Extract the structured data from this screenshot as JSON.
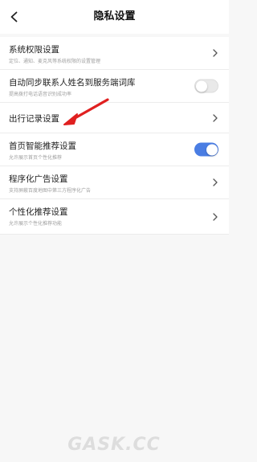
{
  "header": {
    "title": "隐私设置"
  },
  "colors": {
    "toggle_on": "#4a7de3",
    "toggle_off": "#e9e9e9",
    "annotation_arrow": "#e02020"
  },
  "settings": [
    {
      "title": "系统权限设置",
      "subtitle": "定位、通知、麦克风等系统权限的设置管理",
      "control": "chevron"
    },
    {
      "title": "自动同步联系人姓名到服务端词库",
      "subtitle": "提高拨打电话语音识别成功率",
      "control": "toggle",
      "toggle_on": false
    },
    {
      "title": "出行记录设置",
      "subtitle": "",
      "control": "chevron"
    },
    {
      "title": "首页智能推荐设置",
      "subtitle": "允许展示首页个性化推荐",
      "control": "toggle",
      "toggle_on": true
    },
    {
      "title": "程序化广告设置",
      "subtitle": "支持屏蔽百度地图中第三方程序化广告",
      "control": "chevron"
    },
    {
      "title": "个性化推荐设置",
      "subtitle": "允许展示个性化推荐功能",
      "control": "chevron"
    }
  ],
  "watermark": "GASK.CC"
}
